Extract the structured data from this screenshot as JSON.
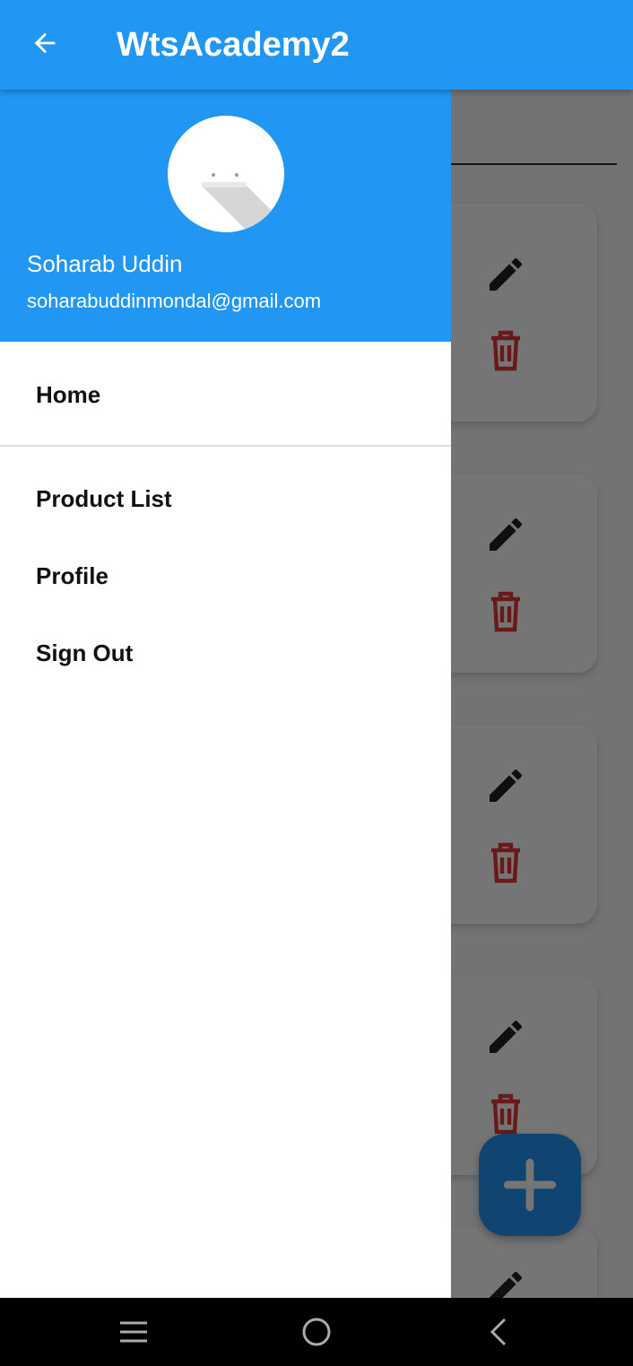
{
  "appbar": {
    "title": "WtsAcademy2",
    "back_icon": "arrow-back-icon"
  },
  "drawer": {
    "user_name": "Soharab Uddin",
    "user_email": "soharabuddinmondal@gmail.com",
    "menu": [
      {
        "label": "Home"
      },
      {
        "label": "Product List"
      },
      {
        "label": "Profile"
      },
      {
        "label": "Sign Out"
      }
    ]
  },
  "colors": {
    "primary": "#2196f3",
    "delete_red": "#e53935",
    "scrim": "rgba(0,0,0,0.54)"
  },
  "system_nav": [
    "recents-icon",
    "home-icon",
    "back-icon"
  ]
}
